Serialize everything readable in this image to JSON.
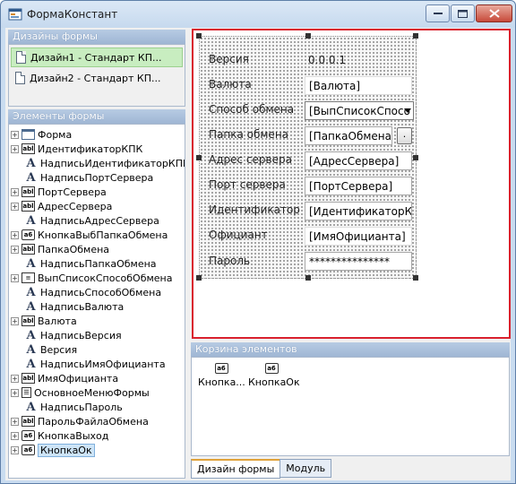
{
  "window": {
    "title": "ФормаКонстант",
    "minimize_symbol": "▬",
    "maximize_symbol": "□",
    "close_symbol": "✕"
  },
  "designs": {
    "header": "Дизайны формы",
    "items": [
      {
        "label": "Дизайн1 - Стандарт КП...",
        "selected": true
      },
      {
        "label": "Дизайн2 - Стандарт КП...",
        "selected": false
      }
    ]
  },
  "elements": {
    "header": "Элементы формы",
    "items": [
      {
        "label": "Форма",
        "icon": "form-icon",
        "expander": "+"
      },
      {
        "label": "ИдентификаторКПК",
        "icon": "textfield-icon",
        "expander": "+"
      },
      {
        "label": "НадписьИдентификаторКПК",
        "icon": "label-icon",
        "expander": ""
      },
      {
        "label": "НадписьПортСервера",
        "icon": "label-icon",
        "expander": ""
      },
      {
        "label": "ПортСервера",
        "icon": "textfield-icon",
        "expander": "+"
      },
      {
        "label": "АдресСервера",
        "icon": "textfield-icon",
        "expander": "+"
      },
      {
        "label": "НадписьАдресСервера",
        "icon": "label-icon",
        "expander": ""
      },
      {
        "label": "КнопкаВыбПапкаОбмена",
        "icon": "button-icon",
        "expander": "+"
      },
      {
        "label": "ПапкаОбмена",
        "icon": "textfield-icon",
        "expander": "+"
      },
      {
        "label": "НадписьПапкаОбмена",
        "icon": "label-icon",
        "expander": ""
      },
      {
        "label": "ВыпСписокСпособОбмена",
        "icon": "dropdown-list-icon",
        "expander": "+"
      },
      {
        "label": "НадписьСпособОбмена",
        "icon": "label-icon",
        "expander": ""
      },
      {
        "label": "НадписьВалюта",
        "icon": "label-icon",
        "expander": ""
      },
      {
        "label": "Валюта",
        "icon": "textfield-icon",
        "expander": "+"
      },
      {
        "label": "НадписьВерсия",
        "icon": "label-icon",
        "expander": ""
      },
      {
        "label": "Версия",
        "icon": "label-icon",
        "expander": ""
      },
      {
        "label": "НадписьИмяОфицианта",
        "icon": "label-icon",
        "expander": ""
      },
      {
        "label": "ИмяОфицианта",
        "icon": "textfield-icon",
        "expander": "+"
      },
      {
        "label": "ОсновноеМенюФормы",
        "icon": "menu-icon",
        "expander": "+"
      },
      {
        "label": "НадписьПароль",
        "icon": "label-icon",
        "expander": ""
      },
      {
        "label": "ПарольФайлаОбмена",
        "icon": "textfield-icon",
        "expander": "+"
      },
      {
        "label": "КнопкаВыход",
        "icon": "button-icon",
        "expander": "+"
      },
      {
        "label": "КнопкаОк",
        "icon": "button-icon",
        "expander": "+",
        "selected": true
      }
    ]
  },
  "icon_glyphs": {
    "textfield": "abl",
    "button": "a6",
    "label": "A",
    "list": "≡",
    "menu": "☰"
  },
  "form": {
    "version_label": "Версия",
    "version_value": "0.0.0.1",
    "currency_label": "Валюта",
    "currency_value": "[Валюта]",
    "exchange_method_label": "Способ обмена",
    "exchange_method_value": "[ВыпСписокСпосо",
    "exchange_folder_label": "Папка обмена",
    "exchange_folder_value": "[ПапкаОбмена]",
    "browse_button": ".",
    "server_address_label": "Адрес сервера",
    "server_address_value": "[АдресСервера]",
    "server_port_label": "Порт сервера",
    "server_port_value": "[ПортСервера]",
    "identifier_label": "Идентификатор",
    "identifier_value": "[ИдентификаторК",
    "waiter_label": "Официант",
    "waiter_value": "[ИмяОфицианта]",
    "password_label": "Пароль",
    "password_value": "***************"
  },
  "basket": {
    "header": "Корзина элементов",
    "items": [
      {
        "label": "Кнопка..."
      },
      {
        "label": "КнопкаОк"
      }
    ]
  },
  "tabs": [
    {
      "label": "Дизайн формы",
      "active": true
    },
    {
      "label": "Модуль",
      "active": false
    }
  ],
  "colors": {
    "selection_border": "#d9212e",
    "selected_design": "#c8edc0",
    "panel_header": "#9fb6d4"
  }
}
